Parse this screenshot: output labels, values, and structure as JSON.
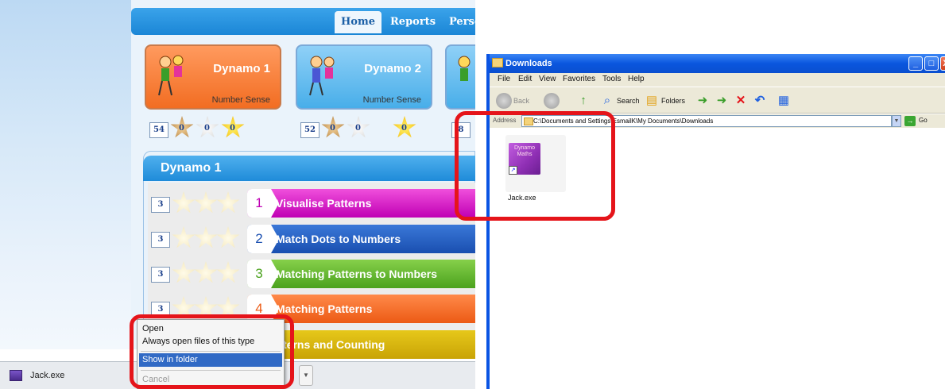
{
  "app": {
    "nav_tabs": [
      {
        "label": "Home"
      },
      {
        "label": "Reports"
      },
      {
        "label": "Perso"
      }
    ],
    "cards": [
      {
        "title": "Dynamo 1",
        "subtitle": "Number Sense",
        "score": "54",
        "star1": "0",
        "star2": "0",
        "star3": "0"
      },
      {
        "title": "Dynamo 2",
        "subtitle": "Number Sense",
        "score": "52",
        "star1": "0",
        "star2": "0",
        "star3": "0"
      },
      {
        "score_partial": "8"
      }
    ],
    "section_title": "Dynamo 1",
    "lessons": [
      {
        "number": "1",
        "label": "Visualise Patterns",
        "score": "3",
        "color": "#c000b4"
      },
      {
        "number": "2",
        "label": "Match Dots to Numbers",
        "score": "3",
        "color": "#1a4fb0"
      },
      {
        "number": "3",
        "label": "Matching Patterns to Numbers",
        "score": "3",
        "color": "#4ba21e"
      },
      {
        "number": "4",
        "label": "Matching Patterns",
        "score": "3",
        "color": "#ec5a14"
      },
      {
        "label": "terns and Counting"
      }
    ]
  },
  "download_bar": {
    "file_name": "Jack.exe"
  },
  "context_menu": {
    "items": [
      {
        "label": "Open",
        "state": "normal"
      },
      {
        "label": "Always open files of this type",
        "state": "normal"
      },
      {
        "label": "Show in folder",
        "state": "selected"
      },
      {
        "label": "Cancel",
        "state": "disabled"
      }
    ]
  },
  "explorer": {
    "title": "Downloads",
    "menu": [
      "File",
      "Edit",
      "View",
      "Favorites",
      "Tools",
      "Help"
    ],
    "toolbar": {
      "back": "Back",
      "search": "Search",
      "folders": "Folders"
    },
    "address_label": "Address",
    "address_value": "C:\\Documents and Settings\\EsmailK\\My Documents\\Downloads",
    "go_label": "Go",
    "file": {
      "icon_text": "Dynamo Maths",
      "name": "Jack.exe"
    }
  },
  "colors": {
    "highlight_ring": "#e5141a",
    "xp_title_blue": "#0a56de",
    "menu_selected": "#316ac5"
  }
}
